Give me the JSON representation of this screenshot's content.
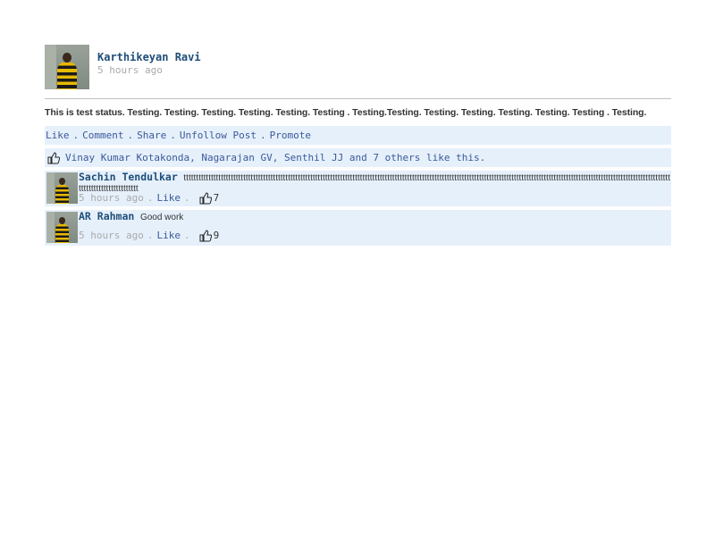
{
  "post": {
    "author": "Karthikeyan Ravi",
    "time": "5 hours ago",
    "status": "This is test status. Testing. Testing. Testing. Testing. Testing. Testing . Testing.Testing. Testing. Testing. Testing. Testing. Testing . Testing."
  },
  "actions": {
    "like": "Like",
    "comment": "Comment",
    "share": "Share",
    "unfollow": "Unfollow Post",
    "promote": "Promote",
    "separator": "."
  },
  "likes": {
    "text": "Vinay Kumar Kotakonda, Nagarajan GV, Senthil JJ and 7 others like this.",
    "icon": "thumbs-up-icon"
  },
  "comments": [
    {
      "author": "Sachin Tendulkar",
      "text": "tttttttttttttttttttttttttttttttttttttttttttttttttttttttttttttttttttttttttttttttttttttttttttttttttttttttttttttttttttttttttttttttttttttttttttttttttttttttttttttttttttttttttttttttttttttttttttttttttttttttttttttttttttttttttttt",
      "time": "5 hours ago",
      "like": "Like",
      "like_count": "7"
    },
    {
      "author": "AR Rahman",
      "text": "Good work",
      "time": "5 hours ago",
      "like": "Like",
      "like_count": "9"
    }
  ],
  "colors": {
    "link": "#3b5998",
    "name": "#1f4e79",
    "bar": "#e6f0fb",
    "muted": "#aaaaaa"
  }
}
